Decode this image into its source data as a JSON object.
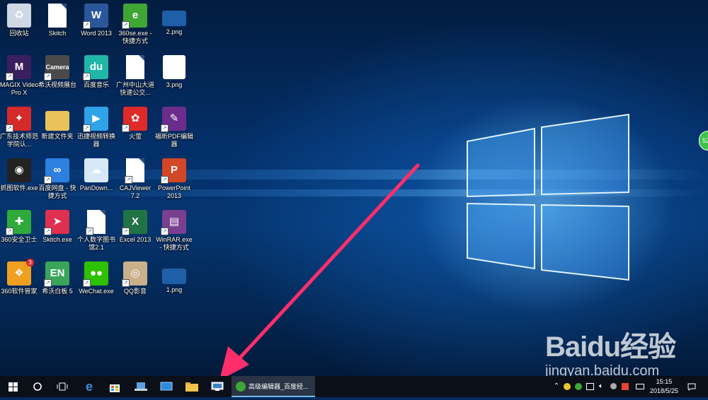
{
  "desktop": {
    "icons": [
      {
        "label": "回收站",
        "type": "recycle",
        "color": "#cfd8e3",
        "glyph": "♻",
        "shortcut": false
      },
      {
        "label": "Skitch",
        "type": "doc",
        "shortcut": false
      },
      {
        "label": "Word 2013",
        "type": "app",
        "color": "#2b579a",
        "glyph": "W",
        "shortcut": true
      },
      {
        "label": "360se.exe - 快捷方式",
        "type": "app",
        "color": "#3fa535",
        "glyph": "e",
        "shortcut": true
      },
      {
        "label": "2.png",
        "type": "image",
        "color": "#1f5fa8",
        "glyph": "",
        "shortcut": false
      },
      {
        "label": "MAGIX Video Pro X",
        "type": "app",
        "color": "#3a1f5e",
        "glyph": "M",
        "shortcut": true
      },
      {
        "label": "希沃视频展台",
        "type": "app",
        "color": "#4a4a4a",
        "glyph": "Camera",
        "shortcut": true
      },
      {
        "label": "百度音乐",
        "type": "app",
        "color": "#1fb6a8",
        "glyph": "du",
        "shortcut": true
      },
      {
        "label": "广州中山大道快速公交...",
        "type": "doc",
        "shortcut": false
      },
      {
        "label": "3.png",
        "type": "image-white",
        "color": "#ffffff",
        "glyph": "",
        "shortcut": false
      },
      {
        "label": "广东技术师范学院认...",
        "type": "app",
        "color": "#d42a2a",
        "glyph": "✦",
        "shortcut": true
      },
      {
        "label": "新建文件夹",
        "type": "folder",
        "color": "#e8c25a",
        "glyph": "",
        "shortcut": false
      },
      {
        "label": "迅捷视频转换器",
        "type": "app",
        "color": "#2ea3e8",
        "glyph": "▶",
        "shortcut": true
      },
      {
        "label": "火萤",
        "type": "app",
        "color": "#e02a2a",
        "glyph": "✿",
        "shortcut": true
      },
      {
        "label": "福昕PDF编辑器",
        "type": "app",
        "color": "#6b2d8c",
        "glyph": "✎",
        "shortcut": true
      },
      {
        "label": "抓图软件.exe",
        "type": "app",
        "color": "#222222",
        "glyph": "◉",
        "shortcut": false
      },
      {
        "label": "百度网盘 - 快捷方式",
        "type": "app",
        "color": "#2f7fe0",
        "glyph": "∞",
        "shortcut": true
      },
      {
        "label": "PanDown...",
        "type": "app",
        "color": "#d7e8f7",
        "glyph": "☁",
        "shortcut": false
      },
      {
        "label": "CAJViewer 7.2",
        "type": "doc",
        "shortcut": true
      },
      {
        "label": "PowerPoint 2013",
        "type": "app",
        "color": "#d24726",
        "glyph": "P",
        "shortcut": true
      },
      {
        "label": "360安全卫士",
        "type": "app",
        "color": "#2eaa3a",
        "glyph": "✚",
        "shortcut": true
      },
      {
        "label": "Skitch.exe",
        "type": "app",
        "color": "#e0304f",
        "glyph": "➤",
        "shortcut": true
      },
      {
        "label": "个人数字图书馆2.1",
        "type": "doc",
        "shortcut": true
      },
      {
        "label": "Excel 2013",
        "type": "app",
        "color": "#217346",
        "glyph": "X",
        "shortcut": true
      },
      {
        "label": "WinRAR.exe - 快捷方式",
        "type": "app",
        "color": "#7b3f8f",
        "glyph": "▤",
        "shortcut": true
      },
      {
        "label": "360软件管家",
        "type": "app",
        "color": "#f0a020",
        "glyph": "❖",
        "shortcut": false
      },
      {
        "label": "希沃白板 5",
        "type": "app",
        "color": "#3aa55a",
        "glyph": "EN",
        "shortcut": true
      },
      {
        "label": "WeChat.exe",
        "type": "app",
        "color": "#2dc100",
        "glyph": "●●",
        "shortcut": true
      },
      {
        "label": "QQ影音",
        "type": "app",
        "color": "#c9b08a",
        "glyph": "◎",
        "shortcut": true
      },
      {
        "label": "1.png",
        "type": "image",
        "color": "#1f5fa8",
        "glyph": "",
        "shortcut": false
      }
    ],
    "badge_360_count": "3",
    "side_badge_text": "52"
  },
  "watermark": {
    "logo_text": "Baidu经验",
    "url": "jingyan.baidu.com"
  },
  "taskbar": {
    "active_window_label": "高级编辑器_百度经...",
    "pinned": [
      "start-icon",
      "cortana-icon",
      "task-view-icon",
      "edge-icon",
      "store-icon",
      "laptop-icon",
      "remote-desktop-icon",
      "file-explorer-icon",
      "network-window-icon"
    ],
    "clock_time": "15:15",
    "clock_date": "2018/5/25"
  },
  "colors": {
    "arrow": "#ff2e6b",
    "taskbar_bg": "#0b0f17",
    "accent": "#76b9ed"
  }
}
